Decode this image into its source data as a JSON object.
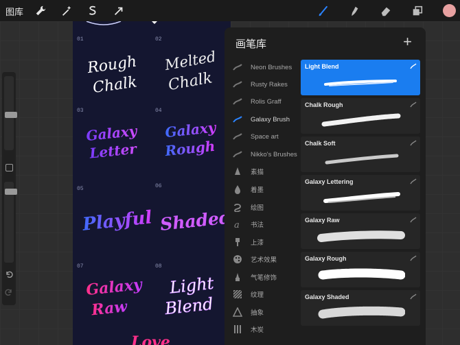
{
  "topbar": {
    "gallery_label": "图库",
    "tools_left": [
      "wrench-icon",
      "magic-wand-icon",
      "selection-s-icon",
      "transform-arrow-icon"
    ],
    "tools_right": [
      "brush-icon",
      "smudge-icon",
      "eraser-icon",
      "layers-icon"
    ],
    "accent": "#2a83ff",
    "color_swatch": "#e8a1a1"
  },
  "artwork": {
    "cells": [
      {
        "num": "01",
        "text": "Rough Chalk"
      },
      {
        "num": "02",
        "text": "Melted Chalk"
      },
      {
        "num": "03",
        "text": "Galaxy Letter"
      },
      {
        "num": "04",
        "text": "Galaxy Rough"
      },
      {
        "num": "05",
        "text": "Playful"
      },
      {
        "num": "06",
        "text": "Shaded"
      },
      {
        "num": "07",
        "text": "Galaxy Raw"
      },
      {
        "num": "08",
        "text": "Light Blend"
      }
    ]
  },
  "panel": {
    "title": "画笔库",
    "add_label": "+",
    "categories": [
      {
        "label": "Neon Brushes",
        "icon": "brush-stroke-icon"
      },
      {
        "label": "Rusty Rakes",
        "icon": "brush-stroke-icon"
      },
      {
        "label": "Rolis Graff",
        "icon": "brush-stroke-icon"
      },
      {
        "label": "Galaxy Brush",
        "icon": "brush-stroke-icon",
        "selected": true
      },
      {
        "label": "Space art",
        "icon": "brush-stroke-icon"
      },
      {
        "label": "Nikko's Brushes",
        "icon": "brush-stroke-icon"
      },
      {
        "label": "素描",
        "icon": "pencil-icon"
      },
      {
        "label": "着墨",
        "icon": "ink-drop-icon"
      },
      {
        "label": "绘图",
        "icon": "swirl-icon"
      },
      {
        "label": "书法",
        "icon": "calligraphy-icon"
      },
      {
        "label": "上漆",
        "icon": "paint-brush-icon"
      },
      {
        "label": "艺术效果",
        "icon": "palette-icon"
      },
      {
        "label": "气笔修饰",
        "icon": "airbrush-icon"
      },
      {
        "label": "纹理",
        "icon": "texture-icon"
      },
      {
        "label": "抽象",
        "icon": "triangle-icon"
      },
      {
        "label": "木炭",
        "icon": "charcoal-icon"
      }
    ],
    "brushes": [
      {
        "name": "Light Blend",
        "selected": true
      },
      {
        "name": "Chalk Rough"
      },
      {
        "name": "Chalk Soft"
      },
      {
        "name": "Galaxy Lettering"
      },
      {
        "name": "Galaxy Raw"
      },
      {
        "name": "Galaxy Rough"
      },
      {
        "name": "Galaxy Shaded"
      }
    ]
  }
}
